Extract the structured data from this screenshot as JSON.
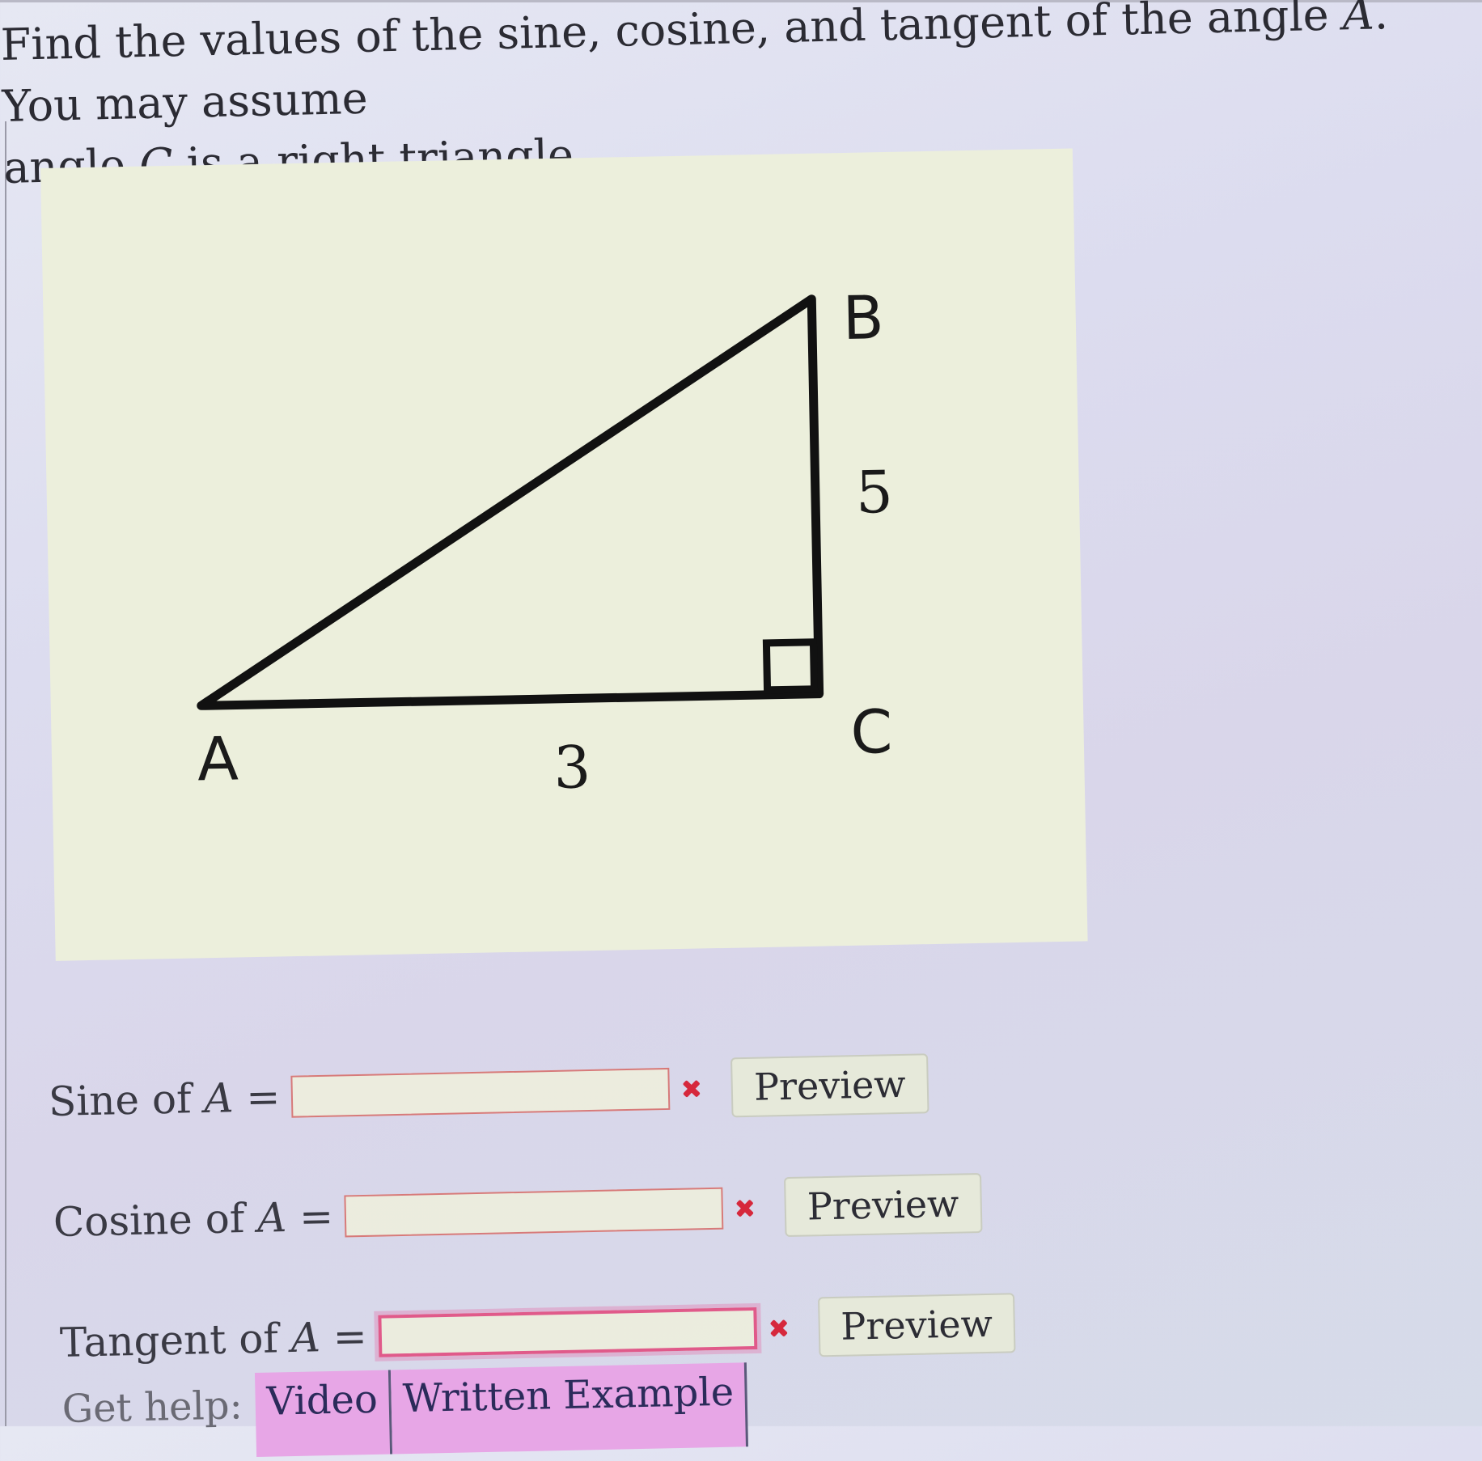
{
  "question": {
    "part1": "Find the values of the sine, cosine, and tangent of the angle ",
    "var1": "A",
    "part2": ". You may assume",
    "part3": "angle ",
    "var2": "C",
    "part4": " is a right triangle."
  },
  "figure": {
    "vertex_a": "A",
    "vertex_b": "B",
    "vertex_c": "C",
    "side_ac": "3",
    "side_bc": "5"
  },
  "answers": [
    {
      "label_prefix": "Sine of ",
      "label_var": "A",
      "label_suffix": " =",
      "value": "",
      "button": "Preview"
    },
    {
      "label_prefix": "Cosine of ",
      "label_var": "A",
      "label_suffix": " =",
      "value": "",
      "button": "Preview"
    },
    {
      "label_prefix": "Tangent of ",
      "label_var": "A",
      "label_suffix": " =",
      "value": "",
      "button": "Preview"
    }
  ],
  "help": {
    "label": "Get help:",
    "links": [
      "Video",
      "Written Example"
    ]
  },
  "colors": {
    "error": "#d6283c",
    "active_input_border": "#e05a8a",
    "help_link_bg": "#e7a6e6"
  },
  "icons": {
    "incorrect": "x-mark-icon"
  }
}
